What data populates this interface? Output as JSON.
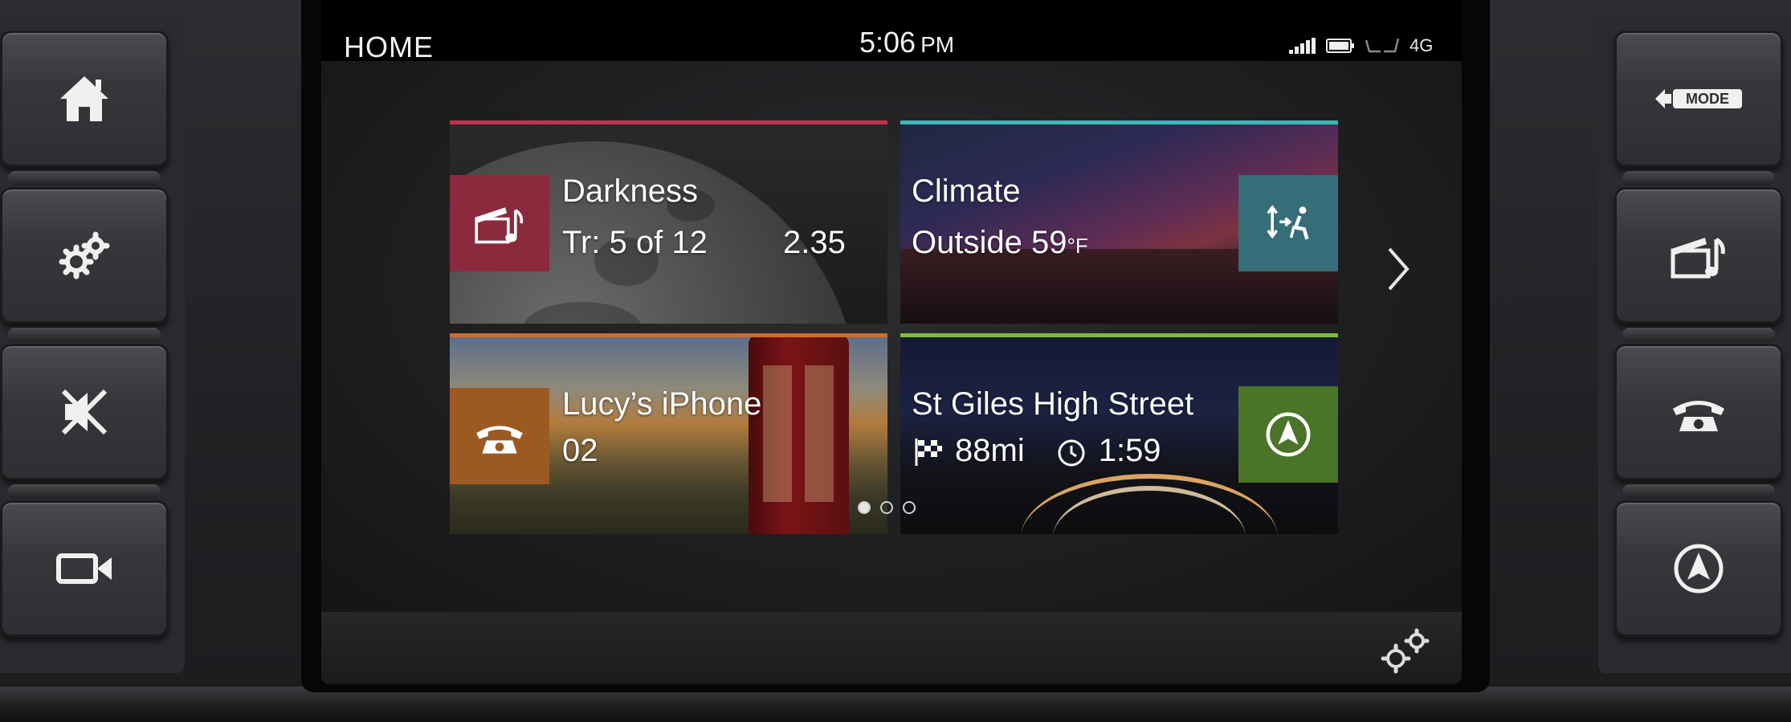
{
  "header": {
    "title": "HOME",
    "time": "5:06",
    "ampm": "PM",
    "network": "4G"
  },
  "tiles": {
    "media": {
      "title": "Darkness",
      "track": "Tr: 5 of 12",
      "time": "2.35",
      "accent": "#c2334f"
    },
    "climate": {
      "title": "Climate",
      "outside_label": "Outside",
      "temperature": "59",
      "unit": "°F",
      "accent": "#3eb6b8"
    },
    "phone": {
      "device": "Lucy’s iPhone",
      "carrier": "02",
      "accent": "#d36a2a"
    },
    "navigation": {
      "street": "St Giles High Street",
      "distance": "88mi",
      "eta": "1:59",
      "accent": "#7dbb3a"
    }
  },
  "pager": {
    "pages": 3,
    "active": 0
  },
  "hardware": {
    "left": [
      "home-icon",
      "settings-icon",
      "mute-icon",
      "camera-icon"
    ],
    "right": [
      "mode-icon",
      "media-icon",
      "phone-icon",
      "navigation-icon"
    ],
    "mode_label": "MODE"
  },
  "icons": {
    "media": "clapper-music-icon",
    "climate": "seat-climate-icon",
    "phone": "telephone-icon",
    "navigation": "navigation-arrow-icon"
  }
}
